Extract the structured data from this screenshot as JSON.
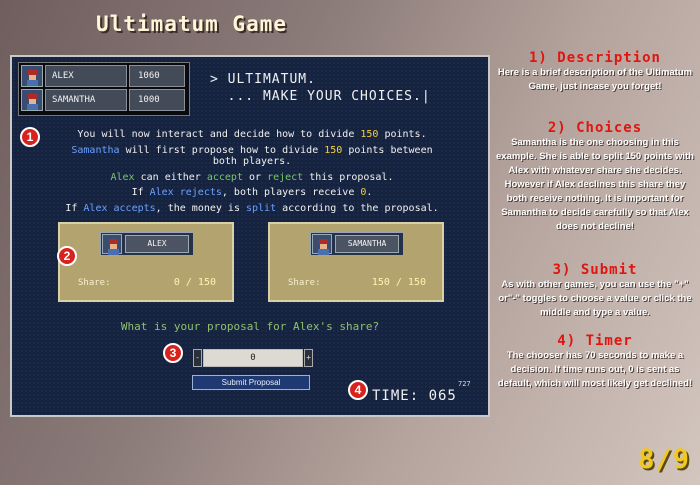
{
  "title": "Ultimatum Game",
  "players": [
    {
      "name": "ALEX",
      "score": "1060"
    },
    {
      "name": "SAMANTHA",
      "score": "1000"
    }
  ],
  "prompt": "> ULTIMATUM.\n  ... MAKE YOUR CHOICES.|",
  "instructions": {
    "l1a": "You will now interact and decide how to divide ",
    "l1b": "150",
    "l1c": " points.",
    "l2a": "Samantha",
    "l2b": " will first propose how to divide ",
    "l2c": "150",
    "l2d": " points between",
    "l3": "both players.",
    "l4a": "Alex",
    "l4b": " can either ",
    "l4c": "accept",
    "l4d": " or ",
    "l4e": "reject",
    "l4f": " this proposal.",
    "l5a": "If ",
    "l5b": "Alex",
    "l5c": " rejects",
    "l5d": ", both players receive ",
    "l5e": "0",
    "l5f": ".",
    "l6a": "If ",
    "l6b": "Alex",
    "l6c": " accepts",
    "l6d": ", the money is ",
    "l6e": "split",
    "l6f": " according to the proposal."
  },
  "cards": [
    {
      "name": "ALEX",
      "share_label": "Share:",
      "share_value": "0 / 150"
    },
    {
      "name": "SAMANTHA",
      "share_label": "Share:",
      "share_value": "150 / 150"
    }
  ],
  "question": "What is your proposal for Alex's share?",
  "stepper": {
    "minus": "-",
    "value": "0",
    "plus": "+"
  },
  "submit_label": "Submit Proposal",
  "timer": {
    "label": "TIME: ",
    "value": "065",
    "small": "727"
  },
  "markers": [
    "1",
    "2",
    "3",
    "4"
  ],
  "sidebar": [
    {
      "heading": "1) Description",
      "body": "Here is a brief description of the Ultimatum Game, just incase you forget!"
    },
    {
      "heading": "2) Choices",
      "body": "Samantha is the one choosing in this example. She is able to split 150 points with Alex with whatever share she decides. However if Alex declines this share they both receive nothing. It is important for Samantha to decide carefully so that Alex does not decline!"
    },
    {
      "heading": "3) Submit",
      "body": "As with other games, you can use the \"+\" or\"-\" toggles to choose a value or click the middle and type a value."
    },
    {
      "heading": "4) Timer",
      "body": "The chooser has 70 seconds to make a decision. If time runs out, 0 is sent as default, which will most likely get declined!"
    }
  ],
  "page_indicator": "8/9"
}
